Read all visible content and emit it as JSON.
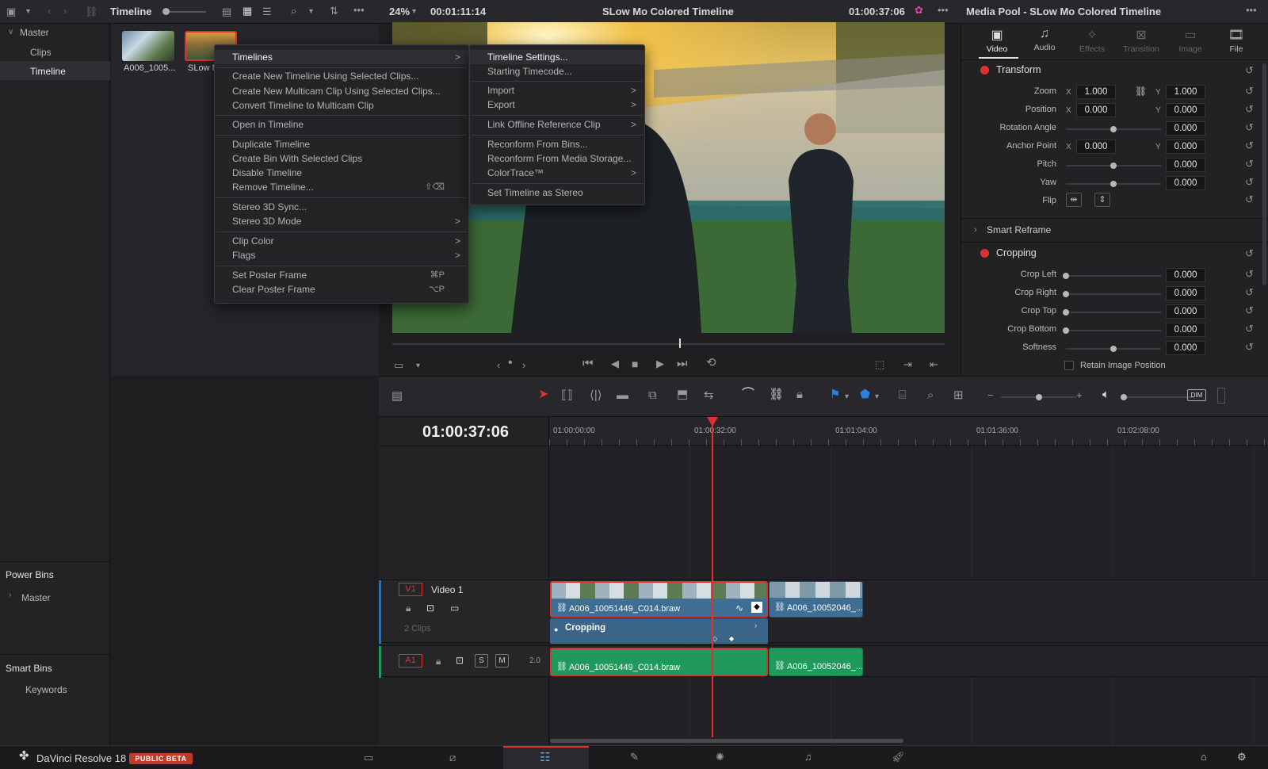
{
  "topbar": {
    "panel_title": "Timeline",
    "zoom": "24%",
    "duration": "00:01:11:14",
    "timeline_name": "SLow Mo Colored Timeline",
    "timecode": "01:00:37:06",
    "inspector_title": "Media Pool - SLow Mo Colored Timeline"
  },
  "sidebar": {
    "master": "Master",
    "items": [
      "Clips",
      "Timeline"
    ],
    "power_bins": "Power Bins",
    "power_master": "Master",
    "smart_bins": "Smart Bins",
    "keywords": "Keywords"
  },
  "bin": {
    "clips": [
      {
        "name": "A006_1005..."
      },
      {
        "name": "SLow M"
      }
    ]
  },
  "context_menu": {
    "items": [
      {
        "label": "Timelines",
        "arrow": ">"
      },
      {
        "label": "Create New Timeline Using Selected Clips..."
      },
      {
        "label": "Create New Multicam Clip Using Selected Clips..."
      },
      {
        "label": "Convert Timeline to Multicam Clip"
      },
      {
        "label": "Open in Timeline"
      },
      {
        "label": "Duplicate Timeline"
      },
      {
        "label": "Create Bin With Selected Clips"
      },
      {
        "label": "Disable Timeline"
      },
      {
        "label": "Remove Timeline...",
        "shortcut": "⇧⌫"
      },
      {
        "label": "Stereo 3D Sync..."
      },
      {
        "label": "Stereo 3D Mode",
        "arrow": ">"
      },
      {
        "label": "Clip Color",
        "arrow": ">"
      },
      {
        "label": "Flags",
        "arrow": ">"
      },
      {
        "label": "Set Poster Frame",
        "shortcut": "⌘P"
      },
      {
        "label": "Clear Poster Frame",
        "shortcut": "⌥P"
      }
    ]
  },
  "submenu": {
    "items": [
      {
        "label": "Timeline Settings..."
      },
      {
        "label": "Starting Timecode..."
      },
      {
        "label": "Import",
        "arrow": ">"
      },
      {
        "label": "Export",
        "arrow": ">"
      },
      {
        "label": "Link Offline Reference Clip",
        "arrow": ">"
      },
      {
        "label": "Reconform From Bins..."
      },
      {
        "label": "Reconform From Media Storage..."
      },
      {
        "label": "ColorTrace™",
        "arrow": ">"
      },
      {
        "label": "Set Timeline as Stereo"
      }
    ]
  },
  "inspector": {
    "tabs": [
      "Video",
      "Audio",
      "Effects",
      "Transition",
      "Image",
      "File"
    ],
    "transform": "Transform",
    "zoom_label": "Zoom",
    "zoom_x": "1.000",
    "zoom_y": "1.000",
    "position_label": "Position",
    "position_x": "0.000",
    "position_y": "0.000",
    "rotation_label": "Rotation Angle",
    "rotation": "0.000",
    "anchor_label": "Anchor Point",
    "anchor_x": "0.000",
    "anchor_y": "0.000",
    "pitch_label": "Pitch",
    "pitch": "0.000",
    "yaw_label": "Yaw",
    "yaw": "0.000",
    "flip_label": "Flip",
    "smart_reframe": "Smart Reframe",
    "cropping": "Cropping",
    "crop_left_label": "Crop Left",
    "crop_left": "0.000",
    "crop_right_label": "Crop Right",
    "crop_right": "0.000",
    "crop_top_label": "Crop Top",
    "crop_top": "0.000",
    "crop_bottom_label": "Crop Bottom",
    "crop_bottom": "0.000",
    "softness_label": "Softness",
    "softness": "0.000",
    "retain": "Retain Image Position",
    "x": "X",
    "y": "Y"
  },
  "timeline": {
    "timecode": "01:00:37:06",
    "ruler": [
      "01:00:00:00",
      "01:00:32:00",
      "01:01:04:00",
      "01:01:36:00",
      "01:02:08:00"
    ],
    "v1": "V1",
    "video1": "Video 1",
    "clips_count": "2 Clips",
    "a1": "A1",
    "audio_ch": "2.0",
    "solo": "S",
    "mute": "M",
    "clip1": "A006_10051449_C014.braw",
    "clip2": "A006_10052046_...",
    "cropping": "Cropping",
    "dim": "DIM"
  },
  "bottombar": {
    "app": "DaVinci Resolve 18",
    "badge": "PUBLIC BETA"
  },
  "colors": {
    "accent_red": "#e03131",
    "video_clip": "#3f6e94",
    "audio_clip": "#1f9a5c"
  }
}
